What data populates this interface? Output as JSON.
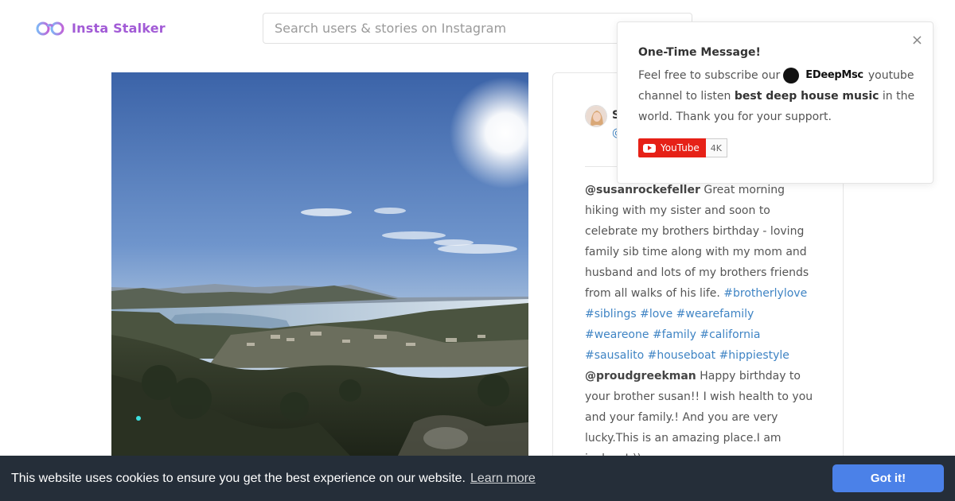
{
  "header": {
    "logo_text": "Insta Stalker",
    "search_placeholder": "Search users & stories on Instagram"
  },
  "post": {
    "author_name": "S",
    "author_handle": "@",
    "comments": [
      {
        "user": "@susanrockefeller",
        "text": " Great morning hiking with my sister and soon to celebrate my brothers birthday - loving family sib time along with my mom and husband and lots of my brothers friends from all walks of his life. ",
        "tags": [
          "#brotherlylove",
          "#siblings",
          "#love",
          "#wearefamily",
          "#weareone",
          "#family",
          "#california",
          "#sausalito",
          "#houseboat",
          "#hippiestyle"
        ]
      },
      {
        "user": "@proudgreekman",
        "text": " Happy birthday to your brother susan!! I wish health to you and your family.! And you are very lucky.This is an amazing place.I am jealous!:))",
        "tags": []
      }
    ]
  },
  "popup": {
    "title": "One-Time Message!",
    "line_start": "Feel free to subscribe our",
    "brand_name": "EDeepMsc",
    "line_after_brand": "youtube channel to listen ",
    "bold_phrase": "best deep house music",
    "line_end": " in the world. Thank you for your support.",
    "youtube_label": "YouTube",
    "subscriber_count": "4K",
    "close_symbol": "×"
  },
  "cookie": {
    "message": "This website uses cookies to ensure you get the best experience on our website.",
    "learn_more": "Learn more",
    "accept": "Got it!"
  },
  "colors": {
    "logo": "#a25bd6",
    "hashtag": "#3f84c4",
    "cookie_bar": "#252e39",
    "cookie_button": "#4b81e8",
    "youtube_red": "#e62117"
  }
}
